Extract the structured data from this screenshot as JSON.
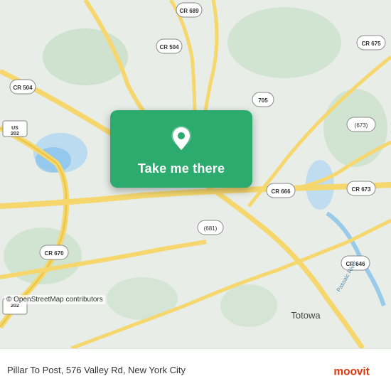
{
  "map": {
    "attribution": "© OpenStreetMap contributors",
    "background_color": "#e8f0e8"
  },
  "card": {
    "button_label": "Take me there",
    "pin_icon": "location-pin"
  },
  "bottom_bar": {
    "address": "Pillar To Post, 576 Valley Rd, New York City",
    "logo_alt": "moovit"
  }
}
